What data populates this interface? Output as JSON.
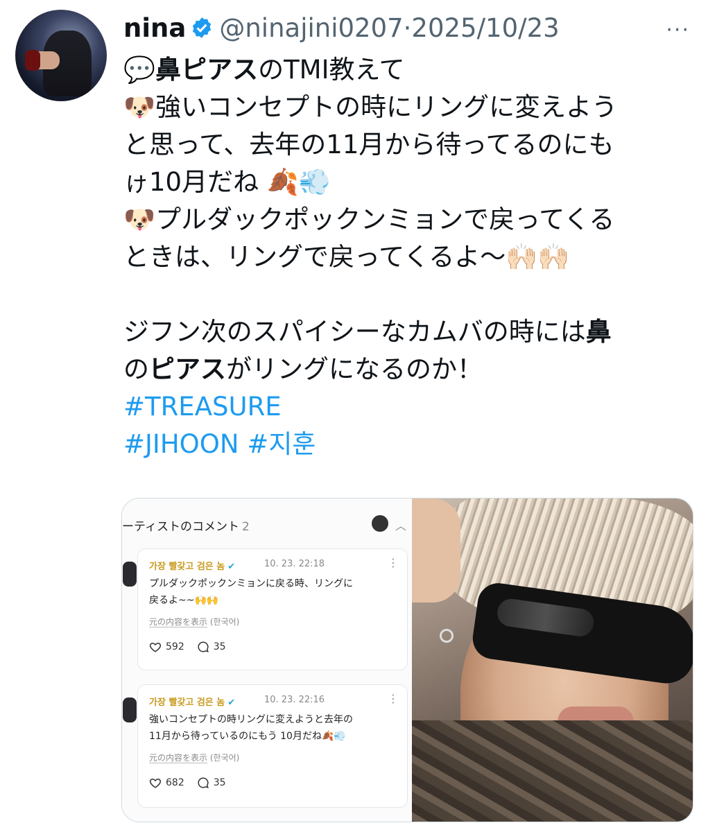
{
  "tweet": {
    "display_name": "nina",
    "handle_date": "@ninajini0207·2025/10/23",
    "more": "···",
    "lines": [
      {
        "emoji": "💬",
        "bold": "鼻ピアス",
        "text": "のTMI教えて"
      },
      {
        "emoji": "🐶",
        "text": "強いコンセプトの時にリングに変えよう"
      },
      {
        "text": "と思って、去年の11月から待ってるのにも"
      },
      {
        "text": "ゖ10月だね",
        "emoji_after": "🍂💨"
      },
      {
        "emoji": "🐶",
        "text": "プルダックポックンミョンで戻ってくる"
      },
      {
        "text": "ときは、リングで戻ってくるよ〜",
        "emoji_after": "🙌🏻🙌🏻"
      }
    ],
    "para2_line1_a": "ジフン次のスパイシーなカムバの時には",
    "para2_line1_b": "鼻",
    "para2_line2_a": "の",
    "para2_line2_b": "ピアス",
    "para2_line2_c": "がリングになるのか！",
    "hashtags": [
      "#TREASURE",
      "#JIHOON",
      "#지훈"
    ]
  },
  "card": {
    "title": "ーティストのコメント",
    "count": "2",
    "comments": [
      {
        "author": "가장 빨갗고 검은 놈",
        "time": "10. 23. 22:18",
        "text1": "プルダックポックンミョンに戻る時、リングに",
        "text2": "戻るよ~~🙌🙌",
        "original_link": "元の内容を表示",
        "original_lang": "(한국어)",
        "likes": "592",
        "replies": "35"
      },
      {
        "author": "가장 빨갗고 검은 놈",
        "time": "10. 23. 22:16",
        "text1": "強いコンセプトの時リングに変えようと去年の",
        "text2": "11月から待っているのにもう 10月だね🍂💨",
        "original_link": "元の内容を表示",
        "original_lang": "(한국어)",
        "likes": "682",
        "replies": "35"
      }
    ]
  },
  "colors": {
    "verified": "#1d9bf0",
    "hashtag": "#1d9bf0",
    "secondary_text": "#536471",
    "comment_author": "#c99a1e"
  },
  "icons": [
    "verified-badge-icon",
    "more-icon",
    "chevron-up-icon",
    "heart-icon",
    "comment-bubble-icon",
    "kebab-menu-icon"
  ]
}
